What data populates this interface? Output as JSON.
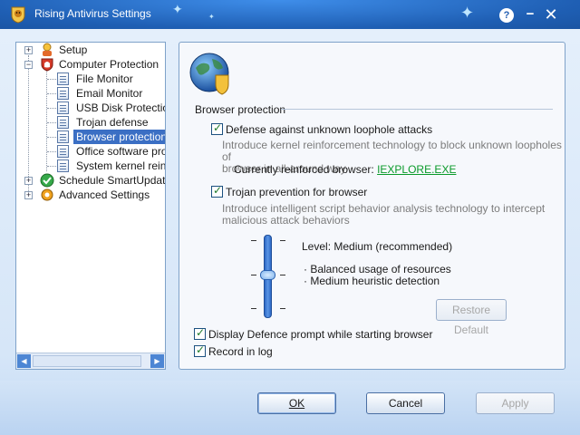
{
  "window": {
    "title": "Rising Antivirus Settings",
    "help_label": "?",
    "minimize_label": "−",
    "close_label": "✕"
  },
  "tree": {
    "items": [
      {
        "label": "Setup",
        "expander": "+"
      },
      {
        "label": "Computer Protection",
        "expander": "−"
      },
      {
        "label": "File Monitor"
      },
      {
        "label": "Email Monitor"
      },
      {
        "label": "USB Disk Protection"
      },
      {
        "label": "Trojan defense"
      },
      {
        "label": "Browser protection",
        "selected": true
      },
      {
        "label": "Office software prote"
      },
      {
        "label": "System kernel reinfo"
      },
      {
        "label": "Schedule SmartUpdate",
        "expander": "+"
      },
      {
        "label": "Advanced Settings",
        "expander": "+"
      }
    ],
    "scroll_left": "◀",
    "scroll_right": "▶"
  },
  "panel": {
    "section_title": "Browser protection",
    "option1": {
      "label": "Defense against unknown loophole attacks",
      "checked": true,
      "desc1": "Introduce kernel reinforcement technology to block unknown loopholes of",
      "desc2": "browser in all-around way",
      "reinforced_label": "Currently reinforced browser:",
      "reinforced_value": "IEXPLORE.EXE"
    },
    "option2": {
      "label": "Trojan prevention for browser",
      "checked": true,
      "desc1": "Introduce intelligent script behavior analysis technology to intercept",
      "desc2": "malicious attack behaviors"
    },
    "level": {
      "label": "Level: Medium (recommended)",
      "bullet1": "· Balanced usage of resources",
      "bullet2": "· Medium heuristic detection",
      "value": "Medium"
    },
    "restore_default_label": "Restore Default",
    "option3": {
      "label": "Display Defence prompt while starting browser",
      "checked": true
    },
    "option4": {
      "label": "Record in log",
      "checked": true
    }
  },
  "buttons": {
    "ok": "OK",
    "cancel": "Cancel",
    "apply": "Apply"
  },
  "colors": {
    "titlebar": "#1f5fb4",
    "selection": "#3b6fc4",
    "link": "#0a9a2a"
  }
}
